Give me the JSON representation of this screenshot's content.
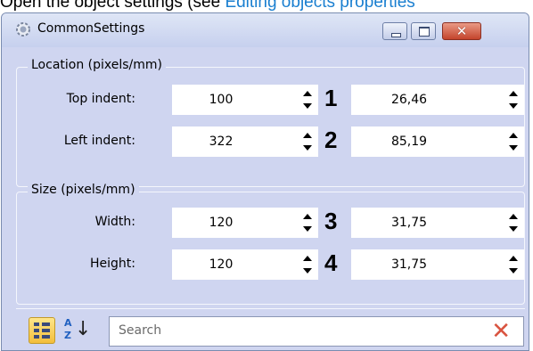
{
  "caption": {
    "prefix": "Open the object settings (see ",
    "link_text": "Editing objects properties"
  },
  "window": {
    "title": "CommonSettings",
    "close_glyph": "✕"
  },
  "location": {
    "group_title": "Location (pixels/mm)",
    "rows": [
      {
        "label": "Top indent:",
        "pixels": "100",
        "mm": "26,46",
        "marker": "1"
      },
      {
        "label": "Left indent:",
        "pixels": "322",
        "mm": "85,19",
        "marker": "2"
      }
    ]
  },
  "size": {
    "group_title": "Size (pixels/mm)",
    "rows": [
      {
        "label": "Width:",
        "pixels": "120",
        "mm": "31,75",
        "marker": "3"
      },
      {
        "label": "Height:",
        "pixels": "120",
        "mm": "31,75",
        "marker": "4"
      }
    ]
  },
  "toolbar": {
    "sort_a": "A",
    "sort_z": "Z",
    "sort_arrow": "↓",
    "search_placeholder": "Search",
    "clear_glyph": "✕"
  },
  "colors": {
    "window_bg": "#cfd5f0",
    "link": "#1a7fd0",
    "clear_icon": "#d9533f"
  }
}
